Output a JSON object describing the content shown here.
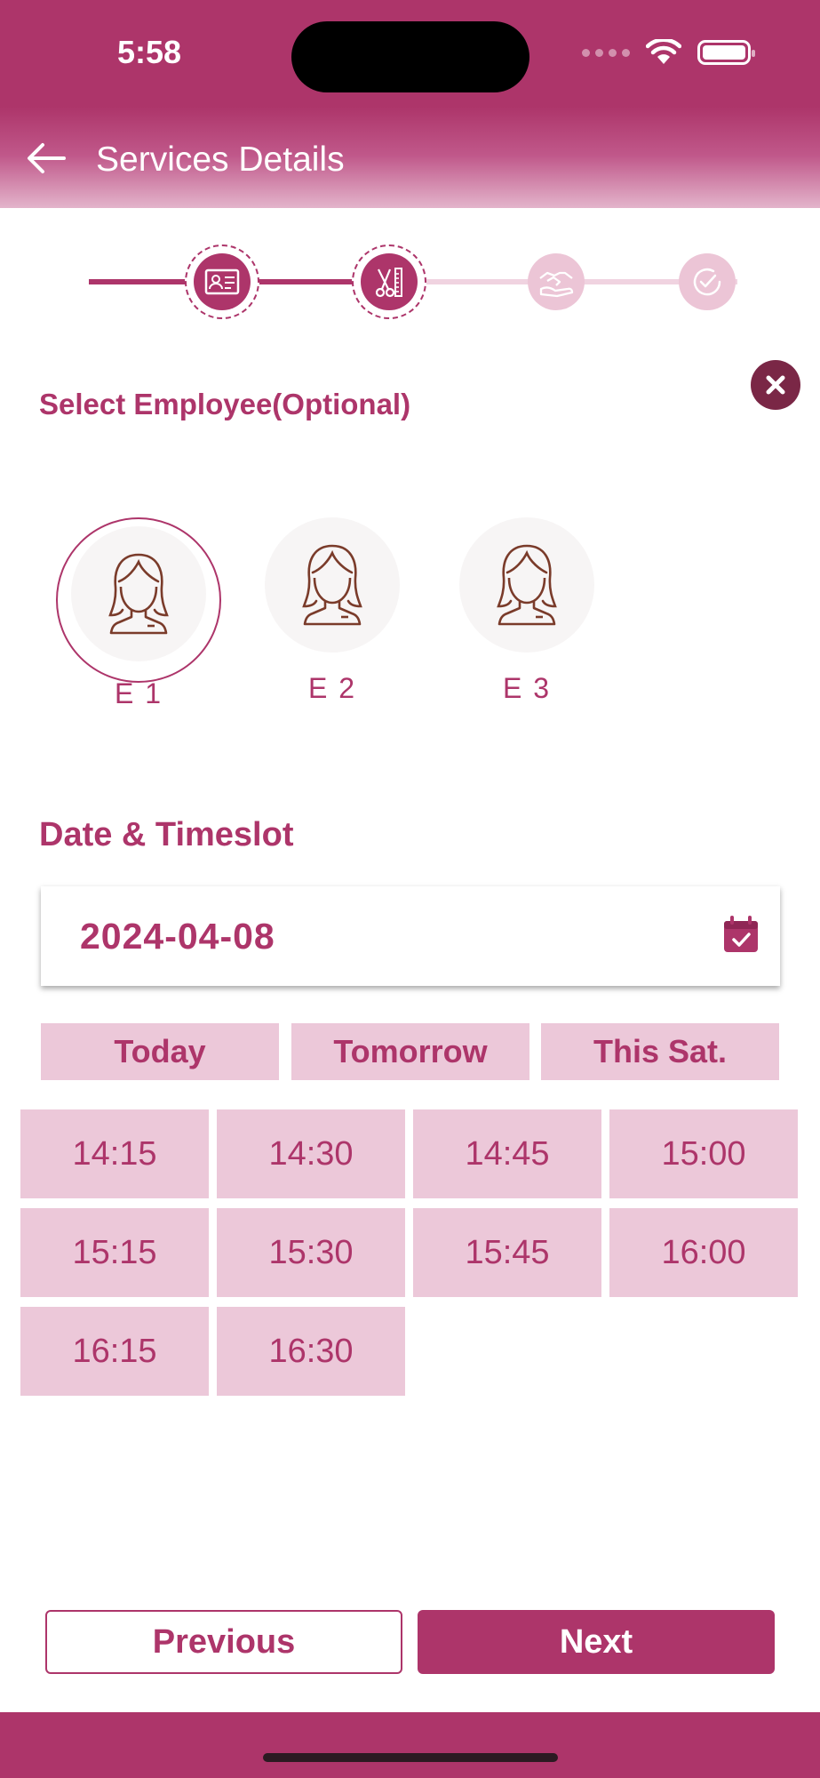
{
  "status_bar": {
    "time": "5:58"
  },
  "header": {
    "title": "Services Details"
  },
  "stepper": {
    "steps": [
      {
        "icon": "id-card-icon",
        "state": "completed"
      },
      {
        "icon": "scissors-comb-icon",
        "state": "current"
      },
      {
        "icon": "handshake-icon",
        "state": "pending"
      },
      {
        "icon": "check-circle-icon",
        "state": "pending"
      }
    ]
  },
  "employee_section": {
    "title": "Select Employee(Optional)",
    "employees": [
      {
        "label": "E 1",
        "selected": true
      },
      {
        "label": "E 2",
        "selected": false
      },
      {
        "label": "E 3",
        "selected": false
      }
    ]
  },
  "date_section": {
    "title": "Date & Timeslot",
    "date_value": "2024-04-08",
    "quick_options": [
      "Today",
      "Tomorrow",
      "This Sat."
    ],
    "time_slots": [
      "14:15",
      "14:30",
      "14:45",
      "15:00",
      "15:15",
      "15:30",
      "15:45",
      "16:00",
      "16:15",
      "16:30"
    ]
  },
  "footer": {
    "previous_label": "Previous",
    "next_label": "Next"
  },
  "colors": {
    "primary": "#ad356a",
    "light": "#ecc8d9",
    "close_button": "#7a2746"
  }
}
